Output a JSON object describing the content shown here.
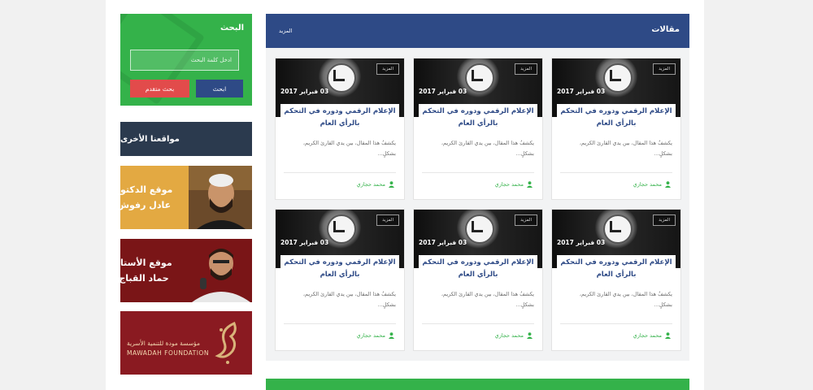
{
  "sidebar": {
    "search": {
      "title": "البحث",
      "placeholder": "ادخل كلمة البحث",
      "search_label": "ابحث",
      "advanced_label": "بحث متقدم"
    },
    "other_sites_title": "مواقعنا الأخرى",
    "banners": [
      {
        "text": "موقع الدكتور عادل رفوش"
      },
      {
        "text": "موقع الأستاذ حماد القباج"
      },
      {
        "text_ar": "مؤسسة مودة للتنمية الأسرية",
        "text_en": "MAWADAH FOUNDATION",
        "logo_text": "مودة"
      }
    ]
  },
  "main": {
    "section_title": "مقالات",
    "more_label": "المزيد",
    "articles": [
      {
        "tag": "المزيد",
        "date": "03 فبراير 2017",
        "title": "الإعلام الرقمي ودوره في التحكم بالرأي العام",
        "excerpt": "يكشفُ هذا المقال، بين يدي القارئ الكريم، بشكلٍ...",
        "author": "محمد حجازي"
      },
      {
        "tag": "المزيد",
        "date": "03 فبراير 2017",
        "title": "الإعلام الرقمي ودوره في التحكم بالرأي العام",
        "excerpt": "يكشفُ هذا المقال، بين يدي القارئ الكريم، بشكلٍ...",
        "author": "محمد حجازي"
      },
      {
        "tag": "المزيد",
        "date": "03 فبراير 2017",
        "title": "الإعلام الرقمي ودوره في التحكم بالرأي العام",
        "excerpt": "يكشفُ هذا المقال، بين يدي القارئ الكريم، بشكلٍ...",
        "author": "محمد حجازي"
      },
      {
        "tag": "المزيد",
        "date": "03 فبراير 2017",
        "title": "الإعلام الرقمي ودوره في التحكم بالرأي العام",
        "excerpt": "يكشفُ هذا المقال، بين يدي القارئ الكريم، بشكلٍ...",
        "author": "محمد حجازي"
      },
      {
        "tag": "المزيد",
        "date": "03 فبراير 2017",
        "title": "الإعلام الرقمي ودوره في التحكم بالرأي العام",
        "excerpt": "يكشفُ هذا المقال، بين يدي القارئ الكريم، بشكلٍ...",
        "author": "محمد حجازي"
      },
      {
        "tag": "المزيد",
        "date": "03 فبراير 2017",
        "title": "الإعلام الرقمي ودوره في التحكم بالرأي العام",
        "excerpt": "يكشفُ هذا المقال، بين يدي القارئ الكريم، بشكلٍ...",
        "author": "محمد حجازي"
      }
    ]
  },
  "colors": {
    "brand_blue": "#2e4a86",
    "brand_green": "#34b24a",
    "danger_red": "#e24b4b",
    "dark_navy": "#2b3a4e"
  }
}
